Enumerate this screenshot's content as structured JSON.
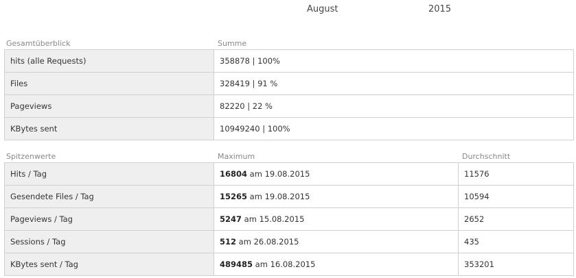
{
  "period": {
    "month": "August",
    "year": "2015"
  },
  "overview": {
    "header_label": "Gesamtüberblick",
    "header_value": "Summe",
    "rows": [
      {
        "label": "hits (alle Requests)",
        "value": "358878 | 100%"
      },
      {
        "label": "Files",
        "value": "328419 | 91 %"
      },
      {
        "label": "Pageviews",
        "value": "82220 | 22 %"
      },
      {
        "label": "KBytes sent",
        "value": "10949240 | 100%"
      }
    ]
  },
  "peaks": {
    "header_label": "Spitzenwerte",
    "header_max": "Maximum",
    "header_avg": "Durchschnitt",
    "rows": [
      {
        "label": "Hits / Tag",
        "max_value": "16804",
        "max_date": " am 19.08.2015",
        "avg": "11576"
      },
      {
        "label": "Gesendete Files / Tag",
        "max_value": "15265",
        "max_date": " am 19.08.2015",
        "avg": "10594"
      },
      {
        "label": "Pageviews / Tag",
        "max_value": "5247",
        "max_date": " am 15.08.2015",
        "avg": "2652"
      },
      {
        "label": "Sessions / Tag",
        "max_value": "512",
        "max_date": " am 26.08.2015",
        "avg": "435"
      },
      {
        "label": "KBytes sent / Tag",
        "max_value": "489485",
        "max_date": " am 16.08.2015",
        "avg": "353201"
      }
    ]
  }
}
